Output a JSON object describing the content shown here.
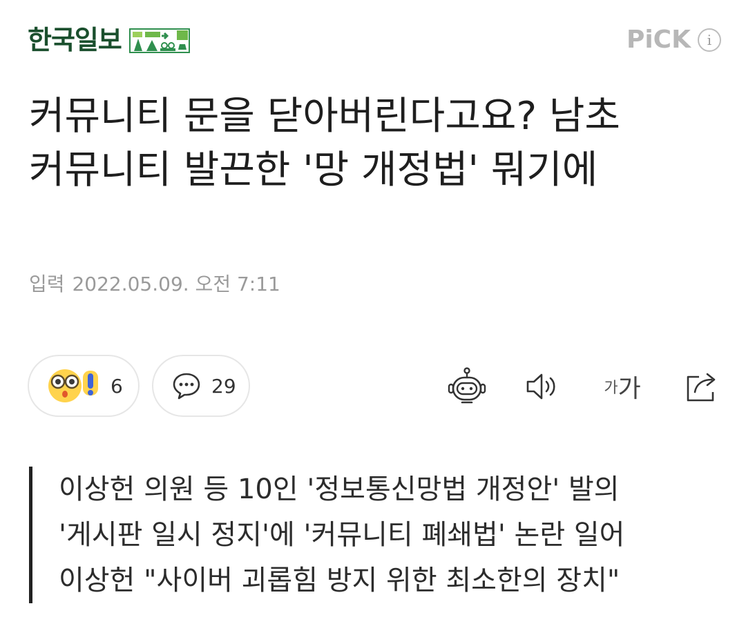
{
  "header": {
    "logo_text": "한국일보",
    "emblem_icon": "forest-people-emblem-icon",
    "pick_label": "PiCK",
    "info_icon": "info-icon",
    "info_glyph": "i"
  },
  "article": {
    "title": "커뮤니티 문을 닫아버린다고요? 남초 커뮤니티 발끈한 '망 개정법' 뭐기에",
    "date_label": "입력",
    "date_value": "2022.05.09. 오전 7:11"
  },
  "reactions": {
    "emotion_icon": "surprised-face-icon",
    "emotion_count": "6",
    "comment_icon": "comment-bubble-icon",
    "comment_count": "29"
  },
  "toolbar": {
    "summary_icon": "robot-summary-icon",
    "tts_icon": "speaker-icon",
    "font_small": "가",
    "font_large": "가",
    "share_icon": "share-icon"
  },
  "subheadings": [
    "이상헌 의원 등 10인 '정보통신망법 개정안' 발의",
    "'게시판 일시 정지'에 '커뮤니티 폐쇄법' 논란 일어",
    "이상헌 \"사이버 괴롭힘 방지 위한 최소한의 장치\""
  ],
  "colors": {
    "logo_green": "#1a4f2d",
    "emblem_green": "#2f8f4e",
    "pick_gray": "#b7b7b7",
    "emoji_yellow": "#ffd34d",
    "alert_blue": "#3d63d9"
  }
}
